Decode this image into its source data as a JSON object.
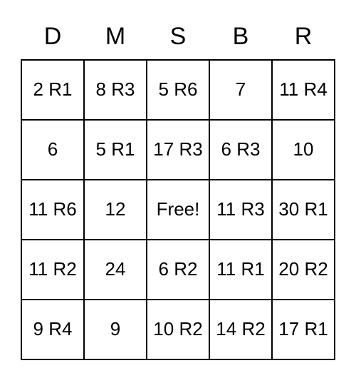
{
  "headers": [
    "D",
    "M",
    "S",
    "B",
    "R"
  ],
  "rows": [
    [
      "2 R1",
      "8 R3",
      "5 R6",
      "7",
      "11 R4"
    ],
    [
      "6",
      "5 R1",
      "17 R3",
      "6 R3",
      "10"
    ],
    [
      "11 R6",
      "12",
      "Free!",
      "11 R3",
      "30 R1"
    ],
    [
      "11 R2",
      "24",
      "6 R2",
      "11 R1",
      "20 R2"
    ],
    [
      "9 R4",
      "9",
      "10 R2",
      "14 R2",
      "17 R1"
    ]
  ]
}
